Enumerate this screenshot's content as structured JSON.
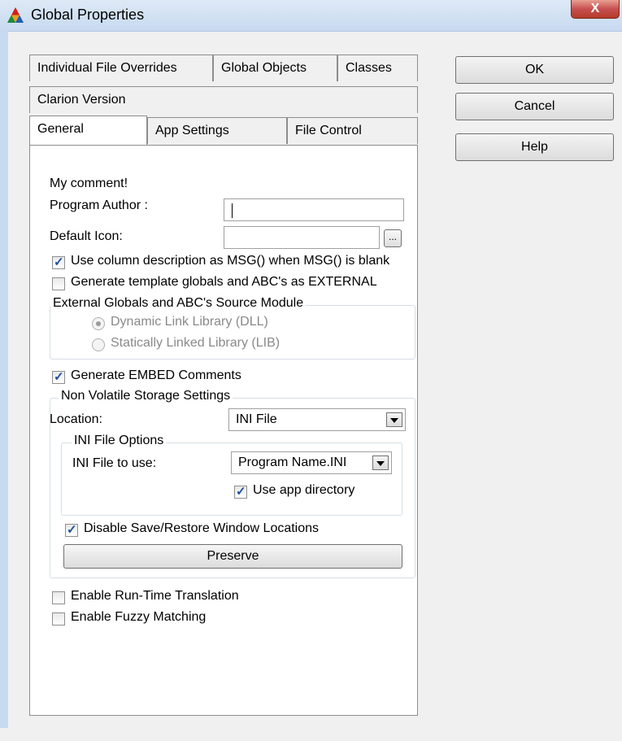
{
  "window": {
    "title": "Global Properties",
    "close_label": "X"
  },
  "tabs": {
    "row1": [
      "Individual File Overrides",
      "Global Objects",
      "Classes"
    ],
    "row2": [
      "Clarion Version"
    ],
    "row3": [
      "General",
      "App Settings",
      "File Control"
    ]
  },
  "buttons": {
    "ok": "OK",
    "cancel": "Cancel",
    "help": "Help"
  },
  "general": {
    "comment": "My comment!",
    "program_author_label": "Program Author :",
    "program_author_value": "",
    "default_icon_label": "Default Icon:",
    "default_icon_value": "",
    "ellipsis_label": "...",
    "use_column_desc_label": "Use column description as MSG() when MSG() is blank",
    "use_column_desc_checked": true,
    "gen_template_globals_label": "Generate template globals and ABC's as EXTERNAL",
    "gen_template_globals_checked": false,
    "external_group_title": "External Globals and ABC's Source Module",
    "dll_option": "Dynamic Link Library (DLL)",
    "lib_option": "Statically Linked Library (LIB)",
    "gen_embed_label": "Generate EMBED Comments",
    "gen_embed_checked": true,
    "nvs_group_title": "Non Volatile Storage Settings",
    "location_label": "Location:",
    "location_value": "INI File",
    "ini_group_title": "INI File Options",
    "ini_file_label": "INI File to use:",
    "ini_file_value": "Program Name.INI",
    "use_app_dir_label": "Use app directory",
    "use_app_dir_checked": true,
    "disable_save_restore_label": "Disable Save/Restore Window Locations",
    "disable_save_restore_checked": true,
    "preserve_label": "Preserve",
    "runtime_translation_label": "Enable Run-Time Translation",
    "runtime_translation_checked": false,
    "fuzzy_matching_label": "Enable Fuzzy Matching",
    "fuzzy_matching_checked": false
  }
}
